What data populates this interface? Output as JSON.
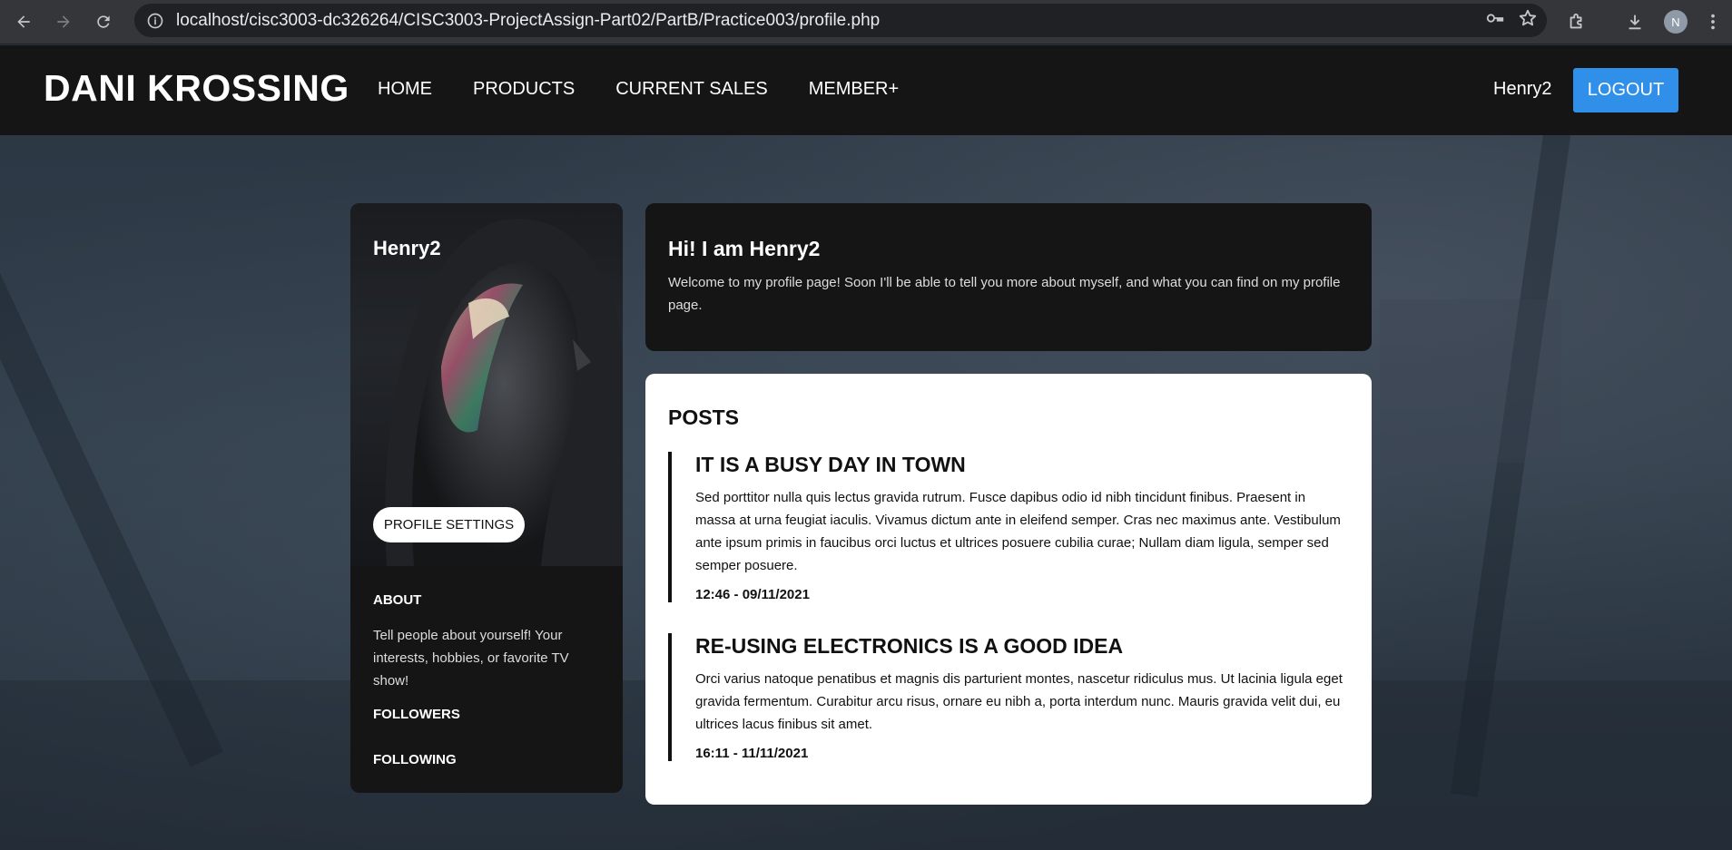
{
  "browser": {
    "url": "localhost/cisc3003-dc326264/CISC3003-ProjectAssign-Part02/PartB/Practice003/profile.php",
    "profile_initial": "N"
  },
  "header": {
    "logo": "DANI KROSSING",
    "nav": [
      "HOME",
      "PRODUCTS",
      "CURRENT SALES",
      "MEMBER+"
    ],
    "username": "Henry2",
    "logout_label": "LOGOUT",
    "accent": "#2f8fe9"
  },
  "sidebar": {
    "username": "Henry2",
    "settings_label": "PROFILE SETTINGS",
    "about_heading": "ABOUT",
    "about_text": "Tell people about yourself! Your interests, hobbies, or favorite TV show!",
    "followers_heading": "FOLLOWERS",
    "following_heading": "FOLLOWING"
  },
  "intro": {
    "heading": "Hi! I am Henry2",
    "text": "Welcome to my profile page! Soon I'll be able to tell you more about myself, and what you can find on my profile page."
  },
  "posts": {
    "title": "POSTS",
    "items": [
      {
        "title": "IT IS A BUSY DAY IN TOWN",
        "body": "Sed porttitor nulla quis lectus gravida rutrum. Fusce dapibus odio id nibh tincidunt finibus. Praesent in massa at urna feugiat iaculis. Vivamus dictum ante in eleifend semper. Cras nec maximus ante. Vestibulum ante ipsum primis in faucibus orci luctus et ultrices posuere cubilia curae; Nullam diam ligula, semper sed semper posuere.",
        "date": "12:46 - 09/11/2021"
      },
      {
        "title": "RE-USING ELECTRONICS IS A GOOD IDEA",
        "body": "Orci varius natoque penatibus et magnis dis parturient montes, nascetur ridiculus mus. Ut lacinia ligula eget gravida fermentum. Curabitur arcu risus, ornare eu nibh a, porta interdum nunc. Mauris gravida velit dui, eu ultrices lacus finibus sit amet.",
        "date": "16:11 - 11/11/2021"
      }
    ]
  }
}
